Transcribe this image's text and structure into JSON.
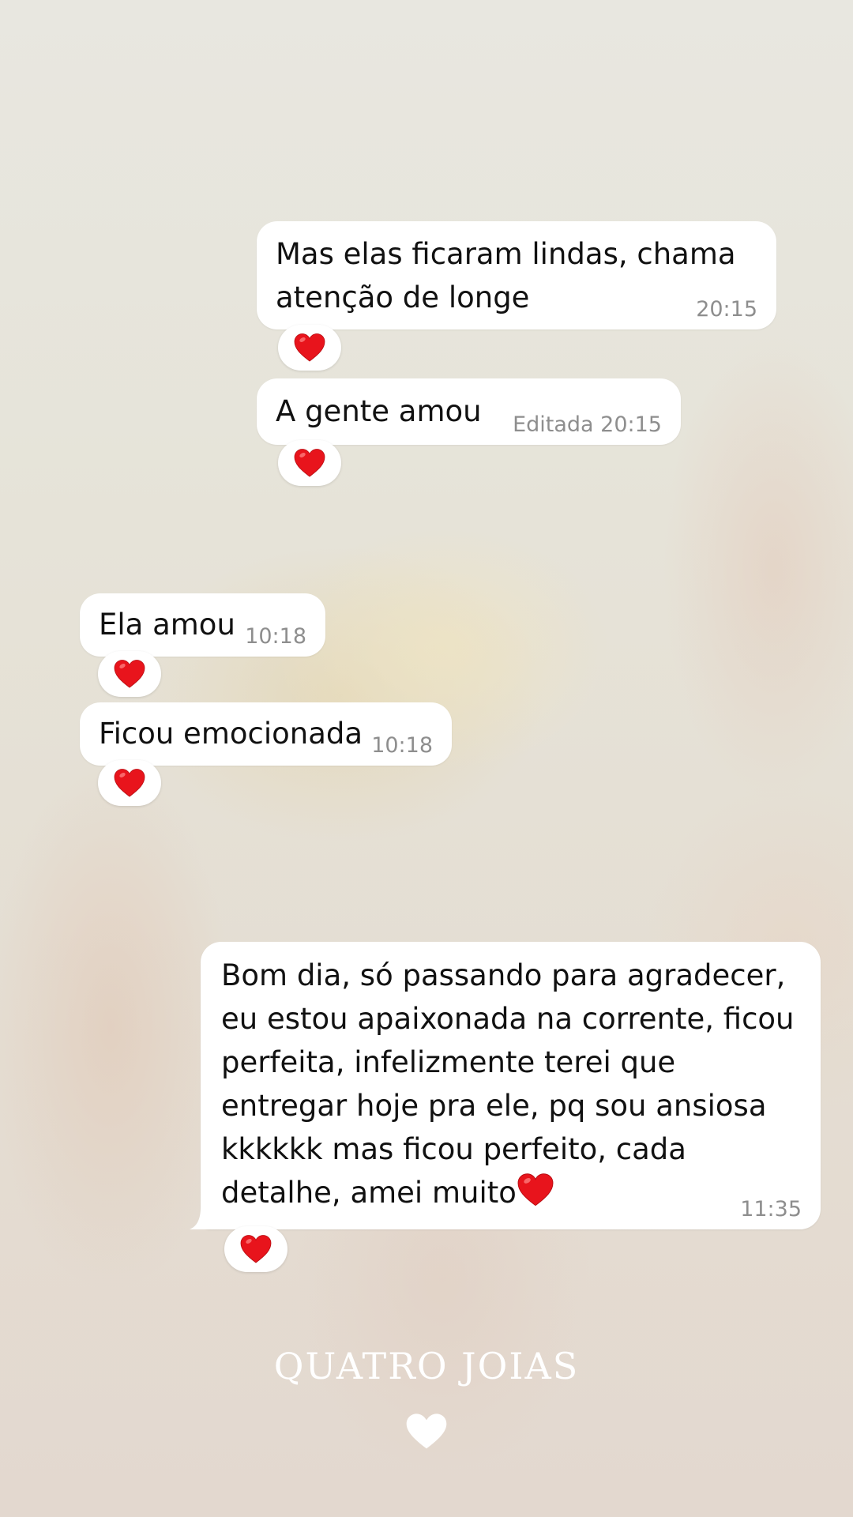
{
  "messages": [
    {
      "id": "m1",
      "direction": "outgoing",
      "text": "Mas elas ficaram lindas, chama atenção de longe",
      "time": "20:15",
      "reaction": "red-heart"
    },
    {
      "id": "m2",
      "direction": "outgoing",
      "text": "A gente amou",
      "time": "Editada 20:15",
      "reaction": "red-heart"
    },
    {
      "id": "m3",
      "direction": "incoming",
      "text": "Ela amou",
      "time": "10:18",
      "reaction": "red-heart"
    },
    {
      "id": "m4",
      "direction": "incoming",
      "text": "Ficou emocionada",
      "time": "10:18",
      "reaction": "red-heart"
    },
    {
      "id": "m5",
      "direction": "incoming",
      "text": "Bom dia, só passando para agradecer, eu estou apaixonada na corrente, ficou perfeita, infelizmente terei que entregar hoje pra ele, pq sou ansiosa kkkkkk mas ficou perfeito, cada detalhe, amei muito",
      "inline_emoji": "red-heart",
      "time": "11:35",
      "reaction": "red-heart"
    }
  ],
  "brand": {
    "name": "QUATRO JOIAS",
    "icon": "white-heart-icon"
  },
  "colors": {
    "bubble": "#ffffff",
    "timestamp": "#8e8e8e",
    "heart": "#e8141c",
    "brand_text": "#ffffff"
  }
}
